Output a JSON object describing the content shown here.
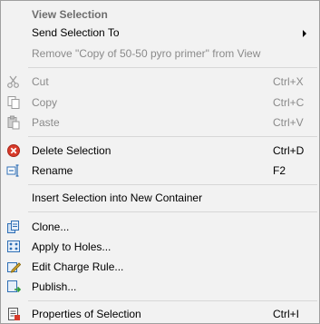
{
  "menu": {
    "header": "View Selection",
    "send_selection_to": "Send Selection To",
    "remove_copy": "Remove \"Copy of 50-50 pyro primer\" from View",
    "cut": {
      "label": "Cut",
      "shortcut": "Ctrl+X"
    },
    "copy": {
      "label": "Copy",
      "shortcut": "Ctrl+C"
    },
    "paste": {
      "label": "Paste",
      "shortcut": "Ctrl+V"
    },
    "delete_selection": {
      "label": "Delete Selection",
      "shortcut": "Ctrl+D"
    },
    "rename": {
      "label": "Rename",
      "shortcut": "F2"
    },
    "insert_into_new_container": "Insert Selection into New Container",
    "clone": "Clone...",
    "apply_to_holes": "Apply to Holes...",
    "edit_charge_rule": "Edit Charge Rule...",
    "publish": "Publish...",
    "properties": {
      "label": "Properties of Selection",
      "shortcut": "Ctrl+I"
    }
  },
  "colors": {
    "menu_bg": "#f2f2f2",
    "disabled_text": "#8a8a8a",
    "delete_icon_red": "#d83a2a",
    "icon_blue": "#2f6fb5"
  },
  "icons": {
    "cut": "scissors-icon",
    "copy": "copy-icon",
    "paste": "paste-icon",
    "delete": "delete-icon",
    "rename": "rename-icon",
    "clone": "clone-icon",
    "apply_to_holes": "apply-to-holes-icon",
    "edit_charge_rule": "edit-charge-rule-icon",
    "publish": "publish-icon",
    "properties": "properties-icon"
  }
}
